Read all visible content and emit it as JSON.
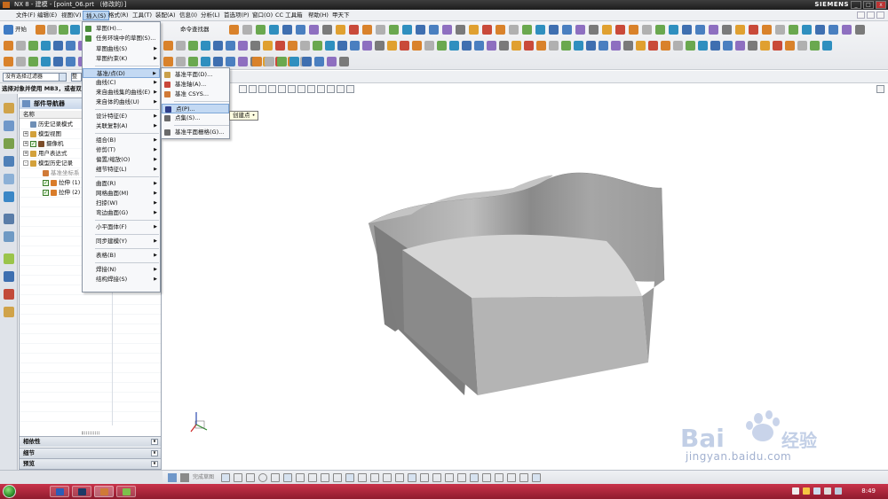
{
  "window": {
    "title": "NX 8 - 建模 - [point_06.prt （修改的）]",
    "brand": "SIEMENS",
    "min": "_",
    "max": "□",
    "close": "x"
  },
  "menubar": {
    "items": [
      "文件(F)",
      "编辑(E)",
      "视图(V)",
      "插入(S)",
      "格式(R)",
      "工具(T)",
      "装配(A)",
      "信息(I)",
      "分析(L)",
      "首选项(P)",
      "窗口(O)",
      "CC 工具箱",
      "帮助(H)",
      "甲天下"
    ],
    "active_index": 3
  },
  "toolbar": {
    "start_label": "开始",
    "cmd_finder_label": "命令查找器"
  },
  "selection": {
    "filter": "没有选择过滤器",
    "scope": "整"
  },
  "cue": "选择对象并使用 MB3，或者双",
  "navigator": {
    "title": "部件导航器",
    "column_name": "名称",
    "nodes": [
      {
        "label": "历史记录模式",
        "indent": 0,
        "expander": "",
        "icon": "history-icon",
        "icon_color": "#6f8fb5",
        "check": false,
        "dim": false
      },
      {
        "label": "模型视图",
        "indent": 0,
        "expander": "+",
        "icon": "view-icon",
        "icon_color": "#d3a13b",
        "check": false,
        "dim": false
      },
      {
        "label": "摄像机",
        "indent": 0,
        "expander": "+",
        "icon": "camera-icon",
        "icon_color": "#7c4d2a",
        "check": true,
        "dim": false
      },
      {
        "label": "用户表达式",
        "indent": 0,
        "expander": "+",
        "icon": "expression-icon",
        "icon_color": "#d3a13b",
        "check": false,
        "dim": false
      },
      {
        "label": "模型历史记录",
        "indent": 0,
        "expander": "-",
        "icon": "history-folder-icon",
        "icon_color": "#d3a13b",
        "check": false,
        "dim": false
      },
      {
        "label": "基准坐标系",
        "indent": 1,
        "expander": "",
        "icon": "datum-csys-icon",
        "icon_color": "#d07a37",
        "check": false,
        "dim": true
      },
      {
        "label": "拉伸 (1)",
        "indent": 1,
        "expander": "",
        "icon": "extrude-icon",
        "icon_color": "#d97c2a",
        "check": true,
        "dim": false
      },
      {
        "label": "拉伸 (2)",
        "indent": 1,
        "expander": "",
        "icon": "extrude-icon",
        "icon_color": "#d97c2a",
        "check": true,
        "dim": false
      }
    ],
    "panels": [
      "相依性",
      "细节",
      "预览"
    ]
  },
  "insert_menu": {
    "items": [
      {
        "label": "草图(H)...",
        "arrow": false,
        "icon": "sketch-icon",
        "icon_color": "#4a8d3a"
      },
      {
        "label": "任务环境中的草图(S)...",
        "arrow": false,
        "icon": "task-sketch-icon",
        "icon_color": "#4a8d3a"
      },
      {
        "label": "草图曲线(S)",
        "arrow": true,
        "icon": "",
        "icon_color": ""
      },
      {
        "label": "草图约束(K)",
        "arrow": true,
        "icon": "",
        "icon_color": ""
      },
      {
        "label": "基准/点(D)",
        "arrow": true,
        "icon": "",
        "icon_color": "",
        "highlight": true
      },
      {
        "label": "曲线(C)",
        "arrow": true,
        "icon": "",
        "icon_color": ""
      },
      {
        "label": "来自曲线集的曲线(E)",
        "arrow": true,
        "icon": "",
        "icon_color": ""
      },
      {
        "label": "来自体的曲线(U)",
        "arrow": true,
        "icon": "",
        "icon_color": ""
      },
      {
        "label": "设计特征(E)",
        "arrow": true,
        "icon": "",
        "icon_color": ""
      },
      {
        "label": "关联复制(A)",
        "arrow": true,
        "icon": "",
        "icon_color": ""
      },
      {
        "label": "组合(B)",
        "arrow": true,
        "icon": "",
        "icon_color": ""
      },
      {
        "label": "修剪(T)",
        "arrow": true,
        "icon": "",
        "icon_color": ""
      },
      {
        "label": "偏置/缩放(O)",
        "arrow": true,
        "icon": "",
        "icon_color": ""
      },
      {
        "label": "细节特征(L)",
        "arrow": true,
        "icon": "",
        "icon_color": ""
      },
      {
        "label": "曲面(R)",
        "arrow": true,
        "icon": "",
        "icon_color": ""
      },
      {
        "label": "网格曲面(M)",
        "arrow": true,
        "icon": "",
        "icon_color": ""
      },
      {
        "label": "扫掠(W)",
        "arrow": true,
        "icon": "",
        "icon_color": ""
      },
      {
        "label": "弯边曲面(G)",
        "arrow": true,
        "icon": "",
        "icon_color": ""
      },
      {
        "label": "小平面体(F)",
        "arrow": true,
        "icon": "",
        "icon_color": ""
      },
      {
        "label": "同步建模(Y)",
        "arrow": true,
        "icon": "",
        "icon_color": ""
      },
      {
        "label": "表格(B)",
        "arrow": true,
        "icon": "",
        "icon_color": ""
      },
      {
        "label": "焊接(N)",
        "arrow": true,
        "icon": "",
        "icon_color": ""
      },
      {
        "label": "结构焊接(S)",
        "arrow": true,
        "icon": "",
        "icon_color": ""
      }
    ]
  },
  "datum_menu": {
    "items": [
      {
        "label": "基准平面(D)...",
        "icon": "datum-plane-icon",
        "icon_color": "#c9a04a"
      },
      {
        "label": "基准轴(A)...",
        "icon": "datum-axis-icon",
        "icon_color": "#c9473a"
      },
      {
        "label": "基准 CSYS...",
        "icon": "datum-csys-icon",
        "icon_color": "#d07a37"
      },
      {
        "label": "点(P)...",
        "icon": "point-icon",
        "icon_color": "#2f3f8a",
        "highlight": true
      },
      {
        "label": "点集(S)...",
        "icon": "point-set-icon",
        "icon_color": "#6a6a6a"
      },
      {
        "label": "基准平面栅格(G)...",
        "icon": "datum-grid-icon",
        "icon_color": "#6a6a6a"
      }
    ]
  },
  "tooltip": "创建点 •",
  "bottom_toolbar": {
    "label": "完成草图"
  },
  "taskbar": {
    "time": "8:49"
  },
  "watermark": {
    "logo": "Bai du 经验",
    "url": "jingyan.baidu.com"
  }
}
